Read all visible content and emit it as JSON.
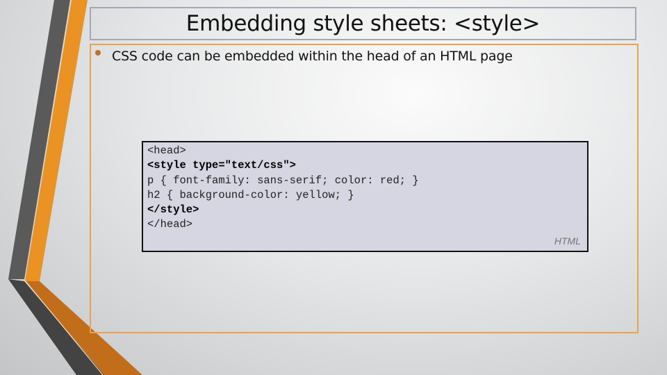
{
  "slide": {
    "title": "Embedding style sheets: <style>",
    "bullet": "CSS code can be embedded within the head of an HTML page",
    "code_lines": [
      {
        "text": "<head>",
        "bold": false
      },
      {
        "text": "<style type=\"text/css\">",
        "bold": true
      },
      {
        "text": "p { font-family: sans-serif; color: red; }",
        "bold": false
      },
      {
        "text": "h2 { background-color: yellow; }",
        "bold": false
      },
      {
        "text": "</style>",
        "bold": true
      },
      {
        "text": "</head>",
        "bold": false
      }
    ],
    "code_language": "HTML"
  },
  "colors": {
    "accent": "#eb9426",
    "dark": "#575757",
    "code_bg": "#d6d5e2"
  }
}
